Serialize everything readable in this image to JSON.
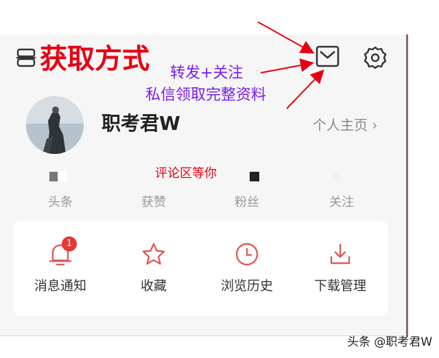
{
  "annotation": {
    "title": "获取方式",
    "note_line1": "转发+关注",
    "note_line2": "私信领取完整资料",
    "comment_note": "评论区等你"
  },
  "profile": {
    "username": "职考君W",
    "homepage_link": "个人主页",
    "chevron_glyph": "›"
  },
  "stats": [
    {
      "label": "头条"
    },
    {
      "label": "获赞"
    },
    {
      "label": "粉丝"
    },
    {
      "label": "关注"
    }
  ],
  "shortcuts": [
    {
      "label": "消息通知",
      "icon": "bell-icon",
      "badge": "1"
    },
    {
      "label": "收藏",
      "icon": "star-icon"
    },
    {
      "label": "浏览历史",
      "icon": "clock-icon"
    },
    {
      "label": "下载管理",
      "icon": "download-icon"
    }
  ],
  "watermark": "头条 @职考君W",
  "colors": {
    "accent_red": "#e60012",
    "icon_red": "#e05a5a",
    "annotation_purple": "#7a1cf0",
    "badge_red": "#e53935"
  }
}
